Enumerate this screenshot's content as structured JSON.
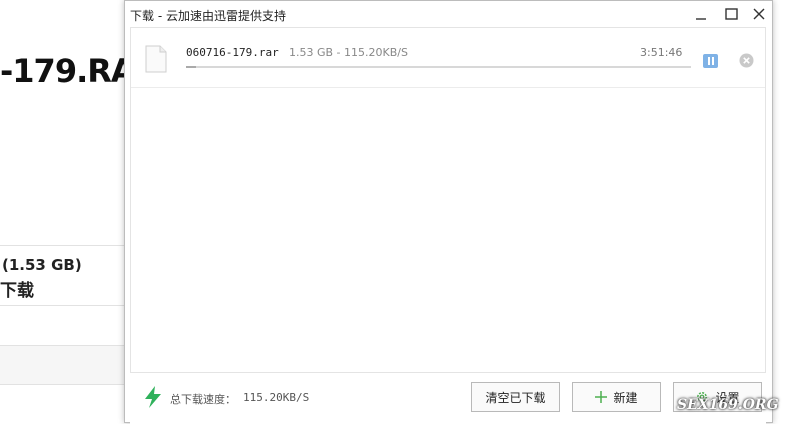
{
  "background_page": {
    "title_fragment": "-179.RA",
    "size_fragment": "(1.53 GB)",
    "download_fragment": "下载"
  },
  "window": {
    "title": "下载 - 云加速由迅雷提供支持"
  },
  "task": {
    "file_name": "060716-179.rar",
    "stats": "1.53 GB - 115.20KB/S",
    "time_remaining": "3:51:46",
    "progress_percent": 2
  },
  "footer": {
    "speed_label": "总下载速度：",
    "speed_value": "115.20KB/S",
    "clear_label": "清空已下载",
    "new_label": "新建",
    "settings_label": "设置"
  },
  "watermark": "SEX169.ORG",
  "colors": {
    "accent_blue": "#7fb2e6",
    "bolt_green": "#2fb15b",
    "plus_green": "#4caf50"
  },
  "icons": {
    "file": "file-icon",
    "pause": "pause-icon",
    "remove": "close-circle-icon",
    "bolt": "lightning-icon",
    "plus": "plus-icon",
    "gear": "gear-icon"
  }
}
